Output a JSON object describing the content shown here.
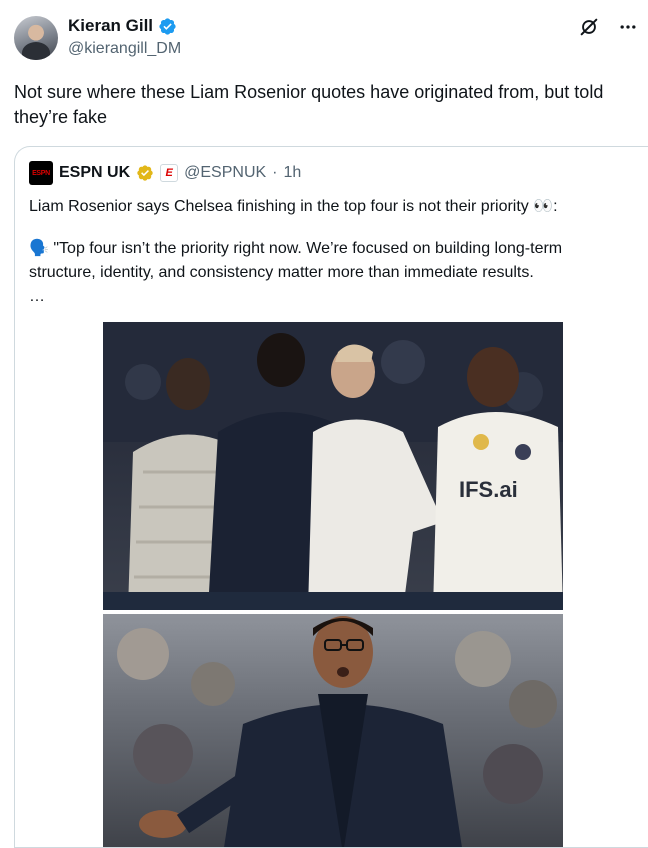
{
  "tweet": {
    "author_name": "Kieran Gill",
    "author_handle": "@kierangill_DM",
    "text": "Not sure where these Liam Rosenior quotes have originated from, but told they’re fake"
  },
  "quoted_tweet": {
    "author_name": "ESPN UK",
    "logo_text": "ESPN",
    "affiliate_badge": "E",
    "author_handle": "@ESPNUK",
    "separator": "·",
    "time": "1h",
    "line1": "Liam Rosenior says Chelsea finishing in the top four is not their priority 👀:",
    "quote_icon": "🗣️",
    "line2": "\"Top four isn’t the priority right now. We’re focused on building long-term structure, identity, and consistency matter more than immediate results.",
    "ellipsis": "…"
  },
  "photo": {
    "shirt_sponsor": "IFS.ai"
  },
  "icons": [
    "verified-badge-icon",
    "grok-icon",
    "more-icon",
    "gold-verified-badge-icon"
  ],
  "colors": {
    "verified_blue": "#1d9bf0",
    "gold_badge": "#e2b719",
    "secondary_text": "#536471",
    "espn_red": "#dd0000"
  }
}
